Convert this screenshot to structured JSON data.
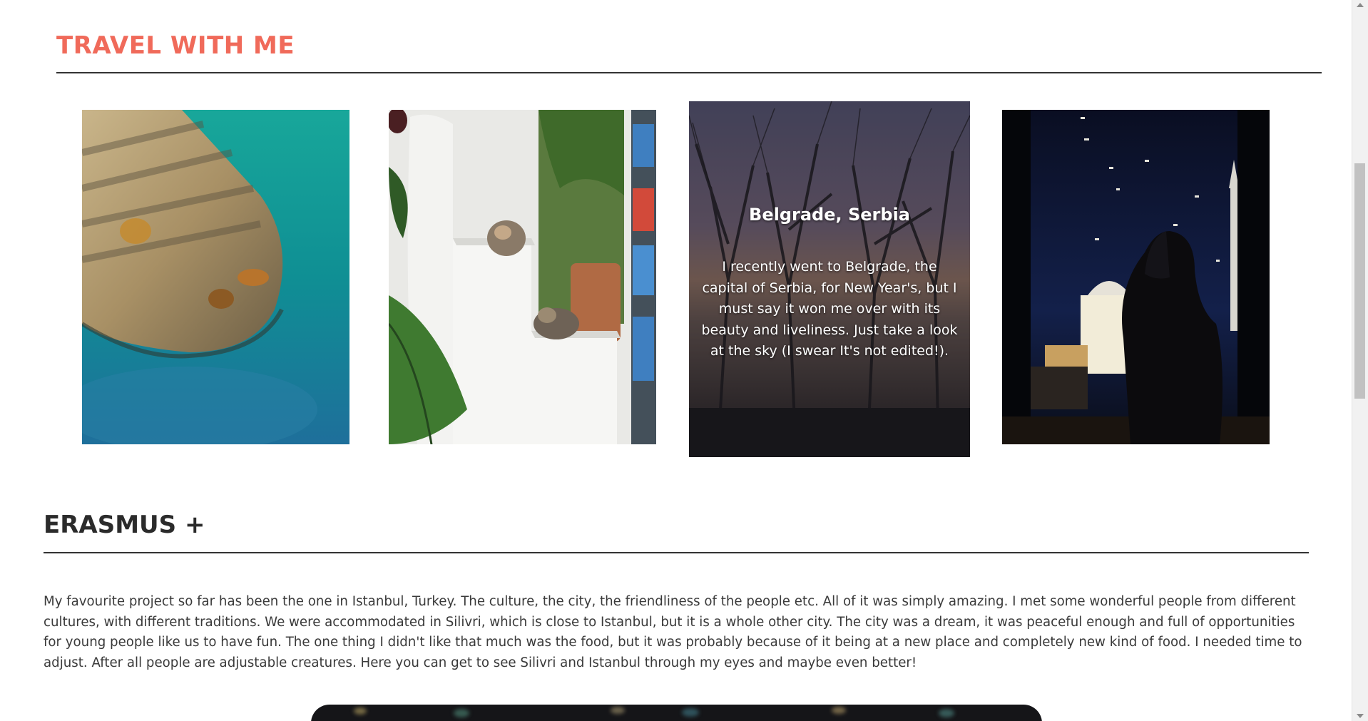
{
  "travel": {
    "title": "TRAVEL WITH ME",
    "cards": [
      {
        "image": "harbor-rocks-photo"
      },
      {
        "image": "cats-on-steps-photo"
      },
      {
        "image": "belgrade-sky-photo",
        "caption_title": "Belgrade, Serbia",
        "caption_text": "I recently went to Belgrade, the capital of Serbia, for New Year's, but I must say it won me over with its beauty and liveliness. Just take a look at the sky (I swear It's not edited!)."
      },
      {
        "image": "mosque-night-view-photo"
      }
    ]
  },
  "erasmus": {
    "title": "ERASMUS +",
    "paragraph": "My favourite project so far has been the one in Istanbul, Turkey. The culture, the city, the friendliness of the people etc. All of it was simply amazing. I met some wonderful people from different cultures, with different traditions. We were accommodated in Silivri, which is close to Istanbul, but it is a whole other city. The city was a dream, it was peaceful enough and full of opportunities for young people like us to have fun. The one thing I didn't like that much was the food, but it was probably because of it being at a new place and completely new kind of food. I needed time to adjust. After all people are adjustable creatures. Here you can get to see Silivri and Istanbul through my eyes and maybe even better!"
  },
  "colors": {
    "accent": "#f06a5a",
    "text": "#333333",
    "rule": "#333333"
  }
}
